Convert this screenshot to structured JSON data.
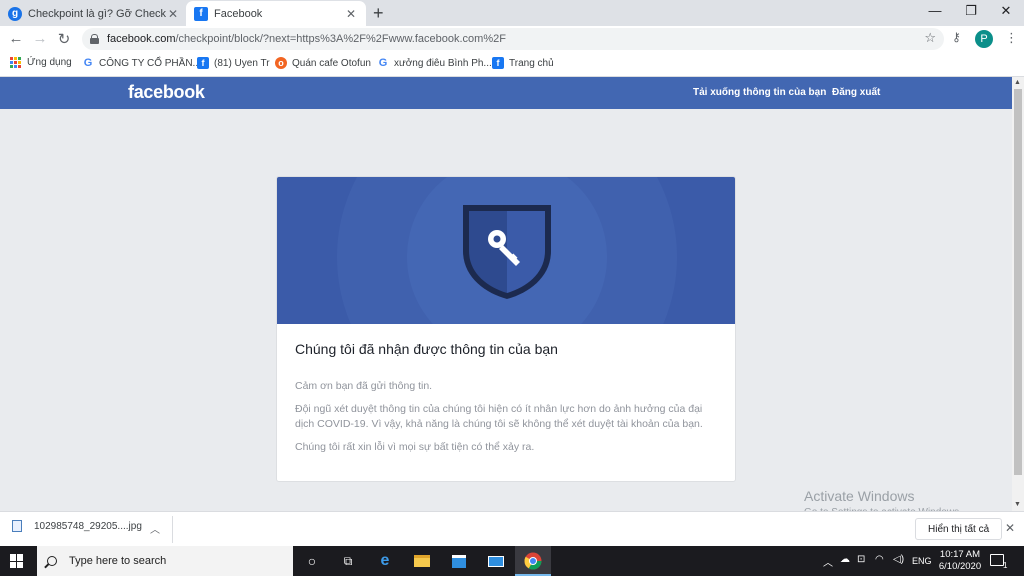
{
  "browser": {
    "tabs": [
      {
        "title": "Checkpoint là gì? Gỡ Checkpoint",
        "favicon_letter": "g",
        "favicon_color": "#1a73e8",
        "active": false
      },
      {
        "title": "Facebook",
        "favicon_letter": "f",
        "favicon_color": "#1877f2",
        "active": true
      }
    ],
    "new_tab_glyph": "+",
    "url_host": "facebook.com",
    "url_path": "/checkpoint/block/?next=https%3A%2F%2Fwww.facebook.com%2F",
    "profile_initial": "P"
  },
  "bookmarks": {
    "items": [
      {
        "label": "Ứng dụng",
        "icon": "apps-grid-icon"
      },
      {
        "label": "CÔNG TY CỔ PHẦN...",
        "icon": "google-icon"
      },
      {
        "label": "(81) Uyen Tr",
        "icon": "facebook-icon"
      },
      {
        "label": "Quán cafe Otofun",
        "icon": "otofun-icon"
      },
      {
        "label": "xưởng điêu Bình Ph...",
        "icon": "google-icon"
      },
      {
        "label": "Trang chủ",
        "icon": "facebook-icon"
      }
    ]
  },
  "facebook": {
    "logo": "facebook",
    "nav": {
      "download": "Tải xuống thông tin của bạn",
      "logout": "Đăng xuất"
    },
    "brand_color": "#4267b2",
    "card": {
      "title": "Chúng tôi đã nhận được thông tin của bạn",
      "p1": "Cảm ơn bạn đã gửi thông tin.",
      "p2": "Đội ngũ xét duyệt thông tin của chúng tôi hiện có ít nhân lực hơn do ảnh hưởng của đại dịch COVID-19. Vì vậy, khả năng là chúng tôi sẽ không thể xét duyệt tài khoản của bạn.",
      "p3": "Chúng tôi rất xin lỗi vì mọi sự bất tiện có thể xảy ra."
    }
  },
  "watermark": {
    "line1": "Activate Windows",
    "line2": "Go to Settings to activate Windows."
  },
  "download_bar": {
    "file_name": "102985748_29205....jpg",
    "show_all": "Hiển thị tất cả"
  },
  "taskbar": {
    "search_placeholder": "Type here to search",
    "language": "ENG",
    "time": "10:17 AM",
    "date": "6/10/2020",
    "notification_count": "1"
  }
}
